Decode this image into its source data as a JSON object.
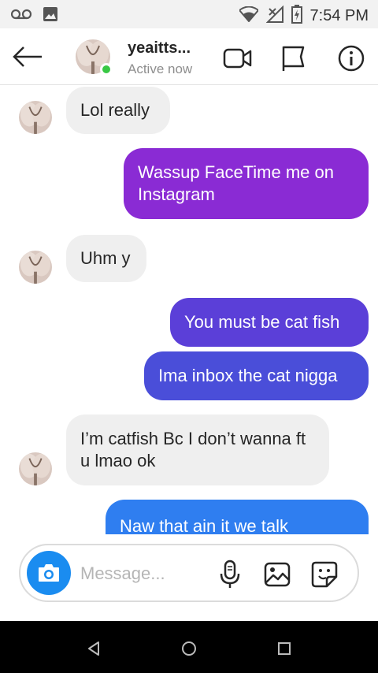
{
  "status_bar": {
    "time": "7:54 PM",
    "icons": [
      "voicemail-icon",
      "image-notification-icon",
      "wifi-icon",
      "signal-icon",
      "battery-icon"
    ]
  },
  "header": {
    "username": "yeaitts...",
    "status": "Active now",
    "icons": [
      "back-arrow-icon",
      "video-call-icon",
      "flag-icon",
      "info-icon"
    ]
  },
  "messages": [
    {
      "direction": "incoming",
      "text": "Lol really"
    },
    {
      "direction": "outgoing",
      "text": "Wassup FaceTime me on Instagram",
      "color": "#8a2bd4"
    },
    {
      "direction": "incoming",
      "text": "Uhm y"
    },
    {
      "direction": "outgoing",
      "text": "You must be cat fish",
      "color": "#5b3fd8"
    },
    {
      "direction": "outgoing",
      "text": "Ima inbox the cat nigga",
      "color": "#4a4ed9"
    },
    {
      "direction": "incoming",
      "text": "I’m catfish Bc I don’t wanna ft u lmao ok"
    },
    {
      "direction": "outgoing",
      "text": "Naw that ain it we talk",
      "color": "#2f7ef0"
    }
  ],
  "composer": {
    "placeholder": "Message...",
    "icons": [
      "camera-icon",
      "microphone-icon",
      "gallery-icon",
      "sticker-icon"
    ]
  },
  "colors": {
    "online": "#38c844",
    "camera_button": "#1a8cf0",
    "incoming_bubble": "#efefef"
  },
  "navbar": {
    "icons": [
      "back-triangle-icon",
      "home-circle-icon",
      "recents-square-icon"
    ]
  }
}
